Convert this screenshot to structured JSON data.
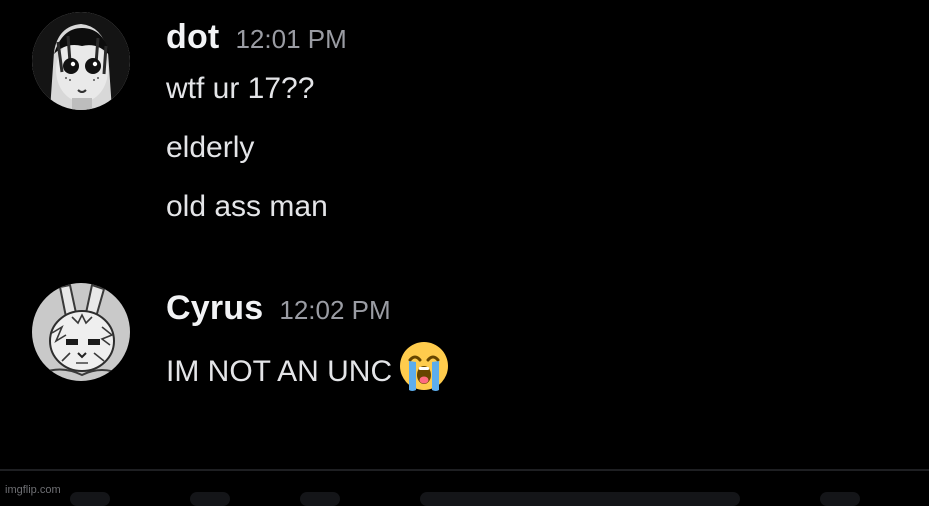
{
  "messages": [
    {
      "username": "dot",
      "timestamp": "12:01 PM",
      "avatar_icon": "dark-hair-girl-avatar-icon",
      "lines": [
        "wtf ur 17??",
        "elderly",
        "old ass man"
      ]
    },
    {
      "username": "Cyrus",
      "timestamp": "12:02 PM",
      "avatar_icon": "sketchy-bunny-avatar-icon",
      "lines": [
        "IM NOT AN UNC"
      ],
      "emoji": "loudly-crying-face-icon"
    }
  ],
  "watermark": "imgflip.com",
  "colors": {
    "background": "#000000",
    "username": "#f2f3f5",
    "message_text": "#e4e5e8",
    "timestamp": "#9a9ca3",
    "divider": "#1e1f22"
  }
}
